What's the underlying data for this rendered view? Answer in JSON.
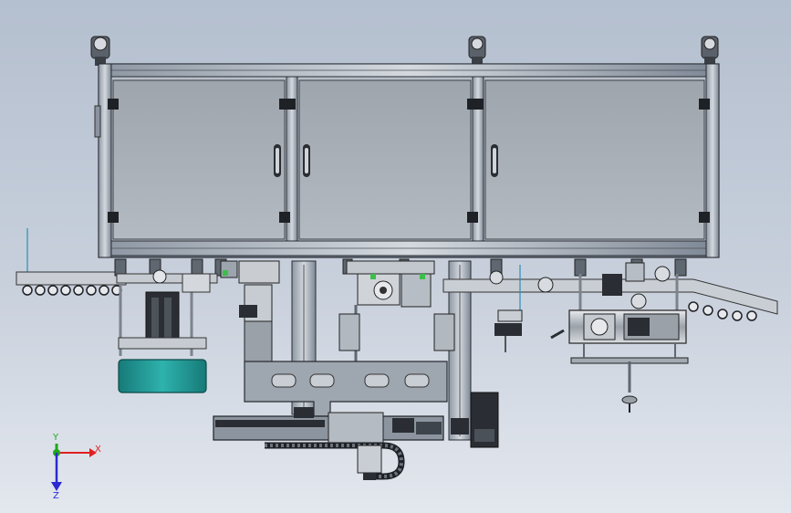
{
  "view": {
    "background_top": "#b4bfcf",
    "background_bottom": "#e3e7ee"
  },
  "machine": {
    "frame_color": "#6e7a88",
    "panel_color": "#a6adb5",
    "metal_color": "#c3c8cf",
    "dark_color": "#2a2d33",
    "teal_color": "#1f8f8c",
    "green_color": "#3cbf4a",
    "door_handle_icon": "door-handle-icon",
    "caster_icon": "caster-wheel-icon"
  },
  "triad": {
    "x_label": "X",
    "y_label": "Y",
    "z_label": "Z",
    "x_color": "#e02020",
    "y_color": "#1ea81e",
    "z_color": "#2a2ad0"
  }
}
